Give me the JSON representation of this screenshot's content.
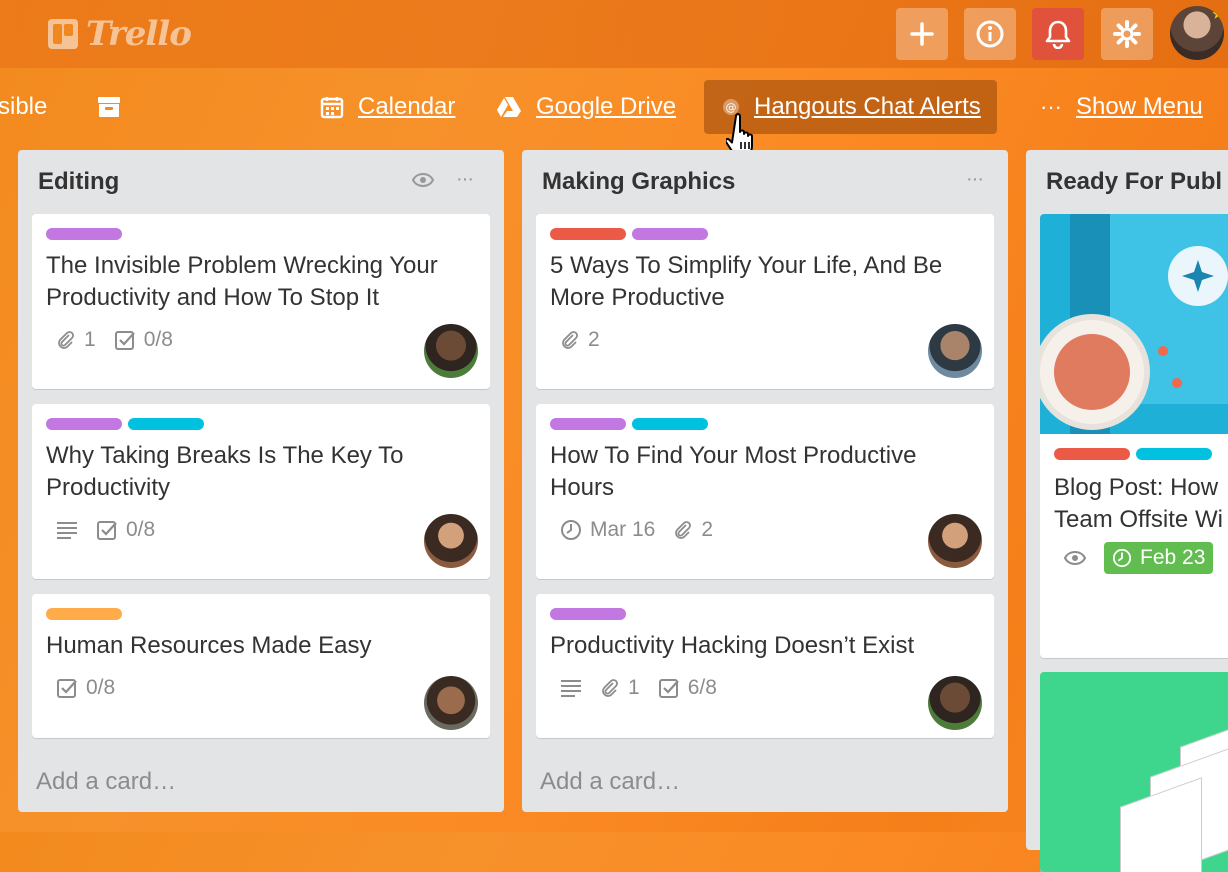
{
  "app": {
    "logo_text": "Trello"
  },
  "header": {
    "buttons": [
      {
        "name": "add-icon"
      },
      {
        "name": "info-icon"
      },
      {
        "name": "bell-icon"
      },
      {
        "name": "gear-icon"
      }
    ]
  },
  "boardbar": {
    "visibility_label": "sible",
    "calendar_label": "Calendar",
    "drive_label": "Google Drive",
    "hangouts_label": "Hangouts Chat Alerts",
    "show_menu_label": "Show Menu",
    "show_menu_dots": "···"
  },
  "lists": [
    {
      "title": "Editing",
      "cards": [
        {
          "labels": [
            "#c377e0"
          ],
          "title_l1": "The Invisible Problem Wrecking Your",
          "title_l2": "Productivity and How To Stop It",
          "attach": "1",
          "checklist": "0/8"
        },
        {
          "labels": [
            "#c377e0",
            "#00c2e0"
          ],
          "title_l1": "Why Taking Breaks Is The Key To",
          "title_l2": "Productivity",
          "checklist": "0/8"
        },
        {
          "labels": [
            "#ffab4a"
          ],
          "title_l1": "Human Resources Made Easy",
          "checklist": "0/8"
        }
      ],
      "add_card": "Add a card…"
    },
    {
      "title": "Making Graphics",
      "cards": [
        {
          "labels": [
            "#eb5a46",
            "#c377e0"
          ],
          "title_l1": "5 Ways To Simplify Your Life, And Be",
          "title_l2": "More Productive",
          "attach": "2"
        },
        {
          "labels": [
            "#c377e0",
            "#00c2e0"
          ],
          "title_l1": "How To Find Your Most Productive",
          "title_l2": "Hours",
          "due": "Mar 16",
          "attach": "2"
        },
        {
          "labels": [
            "#c377e0"
          ],
          "title_l1": "Productivity Hacking Doesn’t Exist",
          "attach": "1",
          "checklist": "6/8"
        }
      ],
      "add_card": "Add a card…"
    },
    {
      "title": "Ready For Publ",
      "cards": [
        {
          "labels": [
            "#eb5a46",
            "#00c2e0"
          ],
          "title_l1": "Blog Post: How",
          "title_l2": "Team Offsite Wi",
          "due": "Feb 23"
        }
      ]
    }
  ],
  "colors": {
    "label_purple": "#c377e0",
    "label_blue": "#00c2e0",
    "label_red": "#eb5a46",
    "label_orange": "#ffab4a",
    "due_complete": "#61bd4f",
    "notification_red": "#e0523c"
  }
}
